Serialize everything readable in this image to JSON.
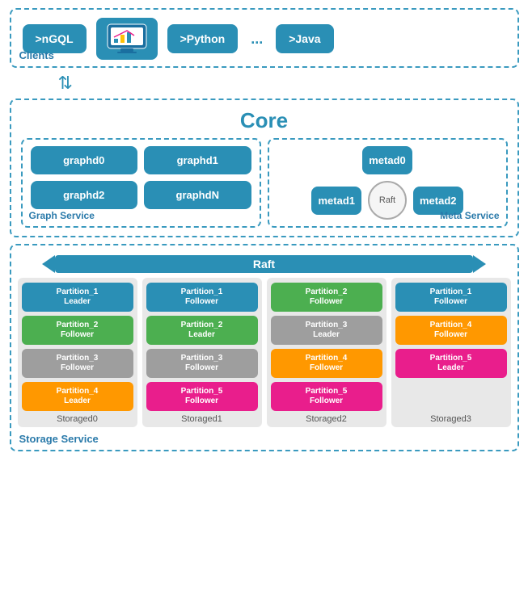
{
  "clients": {
    "label": "Clients",
    "items": [
      {
        "id": "ngql",
        "text": ">nGQL"
      },
      {
        "id": "monitor",
        "type": "icon"
      },
      {
        "id": "python",
        "text": ">Python"
      },
      {
        "id": "dots",
        "text": "..."
      },
      {
        "id": "java",
        "text": ">Java"
      }
    ]
  },
  "arrow": "⇅",
  "core": {
    "title": "Core",
    "graphService": {
      "label": "Graph Service",
      "boxes": [
        "graphd0",
        "graphd1",
        "graphd2",
        "graphdN"
      ]
    },
    "metaService": {
      "label": "Meta Service",
      "boxes": [
        "metad0",
        "metad1",
        "metad2"
      ],
      "raft": "Raft"
    }
  },
  "storage": {
    "label": "Storage Service",
    "raft": "Raft",
    "columns": [
      {
        "name": "Storaged0",
        "partitions": [
          {
            "text": "Partition_1\nLeader",
            "color": "teal"
          },
          {
            "text": "Partition_2\nFollower",
            "color": "green"
          },
          {
            "text": "Partition_3\nFollower",
            "color": "gray"
          },
          {
            "text": "Partition_4\nLeader",
            "color": "orange"
          }
        ]
      },
      {
        "name": "Storaged1",
        "partitions": [
          {
            "text": "Partition_1\nFollower",
            "color": "teal"
          },
          {
            "text": "Partition_2\nLeader",
            "color": "green"
          },
          {
            "text": "Partition_3\nFollower",
            "color": "gray"
          },
          {
            "text": "Partition_5\nFollower",
            "color": "pink"
          }
        ]
      },
      {
        "name": "Storaged2",
        "partitions": [
          {
            "text": "Partition_2\nFollower",
            "color": "green"
          },
          {
            "text": "Partition_3\nLeader",
            "color": "gray"
          },
          {
            "text": "Partition_4\nFollower",
            "color": "orange"
          },
          {
            "text": "Partition_5\nFollower",
            "color": "pink"
          }
        ]
      },
      {
        "name": "Storaged3",
        "partitions": [
          {
            "text": "Partition_1\nFollower",
            "color": "teal"
          },
          {
            "text": "Partition_4\nFollower",
            "color": "orange"
          },
          {
            "text": "Partition_5\nLeader",
            "color": "pink"
          }
        ]
      }
    ]
  }
}
